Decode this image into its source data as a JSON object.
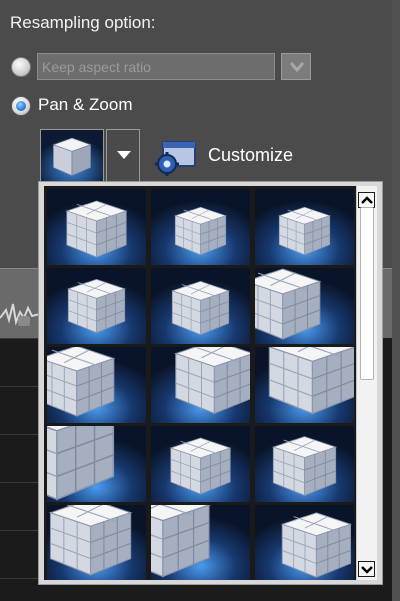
{
  "resampling": {
    "heading": "Resampling option:",
    "options": [
      {
        "label": "Keep aspect ratio",
        "selected": false,
        "disabled": true
      },
      {
        "label": "Pan & Zoom",
        "selected": true,
        "disabled": false
      }
    ]
  },
  "panzoom": {
    "customize_label": "Customize",
    "preset_count": 15,
    "selected_index": 0
  },
  "icons": {
    "dropdown": "chevron-down-icon",
    "customize": "window-gear-icon",
    "scroll_up": "arrow-up-icon",
    "scroll_down": "arrow-down-icon"
  },
  "colors": {
    "selection": "#25d02a",
    "radio_selected": "#2f86e0"
  }
}
